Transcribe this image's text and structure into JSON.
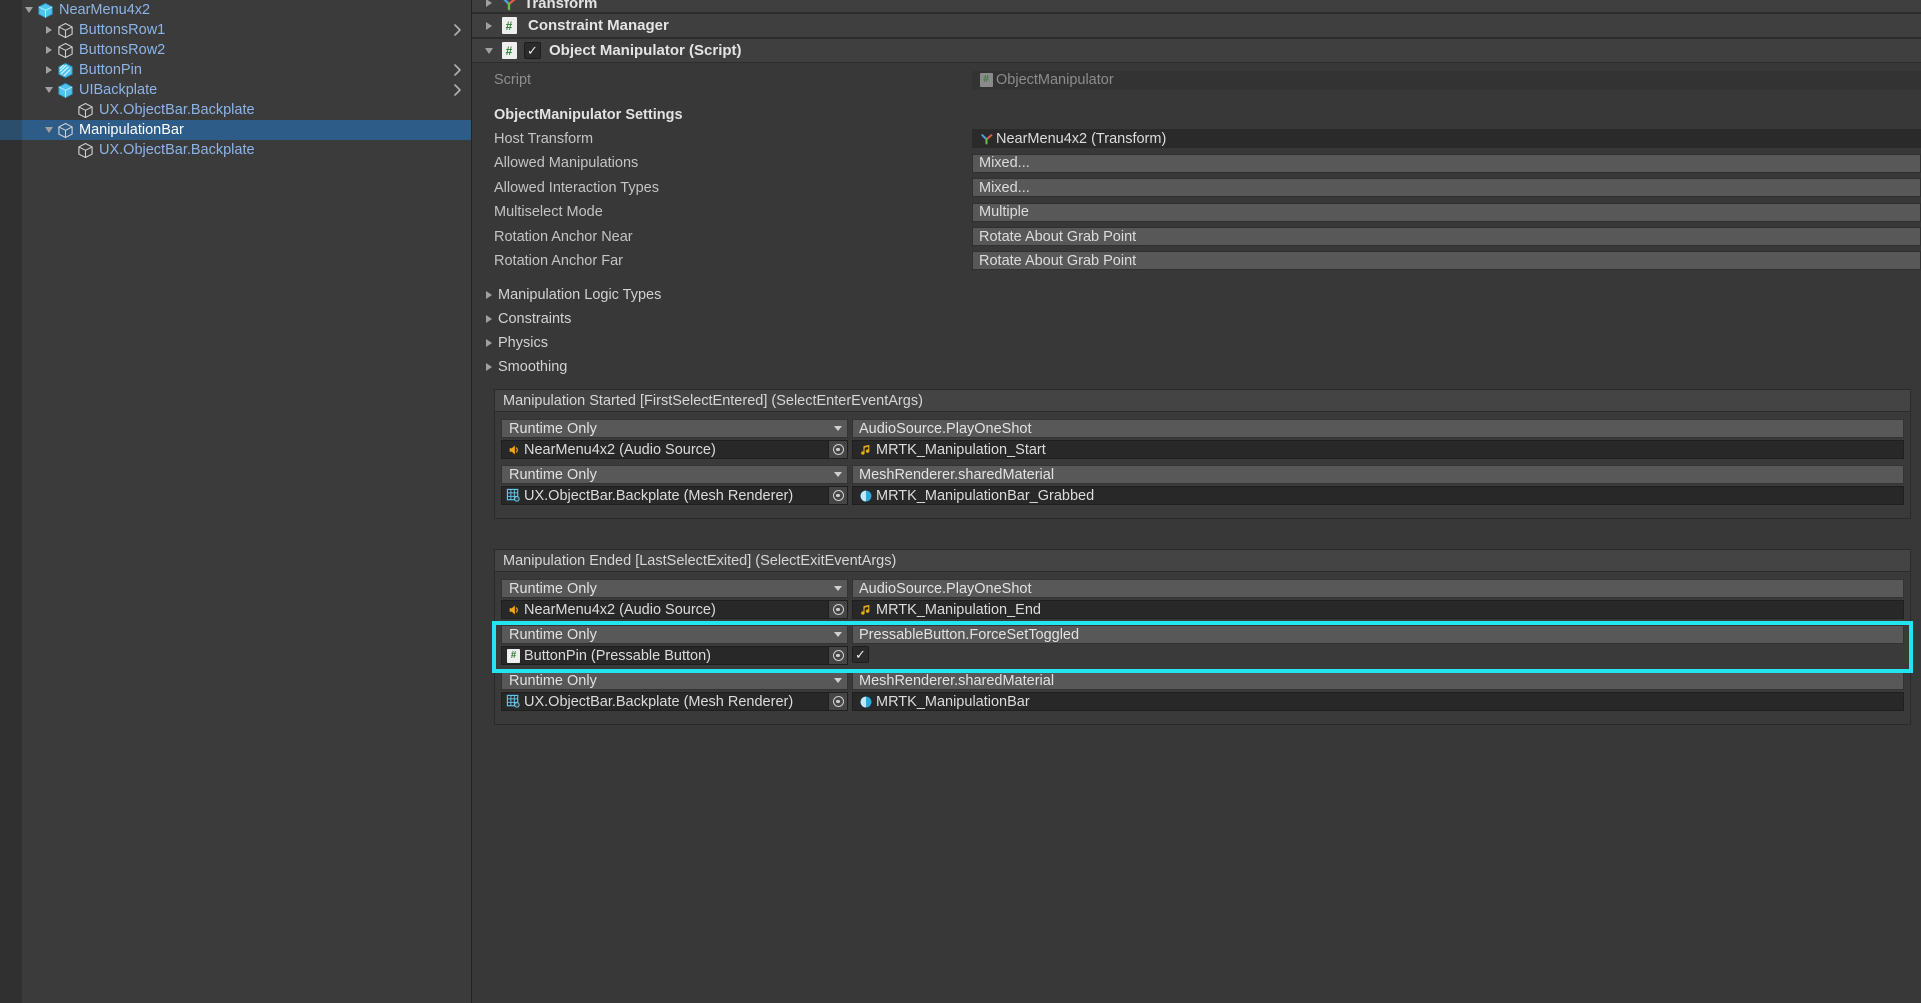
{
  "hierarchy": {
    "items": [
      {
        "label": "NearMenu4x2",
        "indent": 1,
        "twist": "down",
        "icon": "prefab-cube-icon",
        "selected": false,
        "chevron": false
      },
      {
        "label": "ButtonsRow1",
        "indent": 2,
        "twist": "right",
        "icon": "gameobject-cube-icon",
        "selected": false,
        "chevron": true
      },
      {
        "label": "ButtonsRow2",
        "indent": 2,
        "twist": "right",
        "icon": "gameobject-cube-icon",
        "selected": false,
        "chevron": false
      },
      {
        "label": "ButtonPin",
        "indent": 2,
        "twist": "right",
        "icon": "prefab-variant-cube-icon",
        "selected": false,
        "chevron": true
      },
      {
        "label": "UIBackplate",
        "indent": 2,
        "twist": "down",
        "icon": "prefab-cube-icon",
        "selected": false,
        "chevron": true
      },
      {
        "label": "UX.ObjectBar.Backplate",
        "indent": 3,
        "twist": "none",
        "icon": "gameobject-cube-icon",
        "selected": false,
        "chevron": false
      },
      {
        "label": "ManipulationBar",
        "indent": 2,
        "twist": "down",
        "icon": "gameobject-cube-icon",
        "selected": true,
        "chevron": false
      },
      {
        "label": "UX.ObjectBar.Backplate",
        "indent": 3,
        "twist": "none",
        "icon": "gameobject-cube-icon",
        "selected": false,
        "chevron": false
      }
    ]
  },
  "inspector": {
    "components": [
      {
        "title": "Transform",
        "twist": "right",
        "icon": "transform-axis-icon",
        "checkbox": null
      },
      {
        "title": "Constraint Manager",
        "twist": "right",
        "icon": "script-cs-icon",
        "checkbox": null
      },
      {
        "title": "Object Manipulator (Script)",
        "twist": "down",
        "icon": "script-cs-icon",
        "checkbox": true
      }
    ],
    "script_row": {
      "label": "Script",
      "value": "ObjectManipulator",
      "icon": "script-cs-icon"
    },
    "settings_header": "ObjectManipulator Settings",
    "settings": [
      {
        "label": "Host Transform",
        "value": "NearMenu4x2 (Transform)",
        "field": "object",
        "icon": "transform-axis-icon"
      },
      {
        "label": "Allowed Manipulations",
        "value": "Mixed...",
        "field": "enum",
        "icon": null
      },
      {
        "label": "Allowed Interaction Types",
        "value": "Mixed...",
        "field": "enum",
        "icon": null
      },
      {
        "label": "Multiselect Mode",
        "value": "Multiple",
        "field": "enum",
        "icon": null
      },
      {
        "label": "Rotation Anchor Near",
        "value": "Rotate About Grab Point",
        "field": "enum",
        "icon": null
      },
      {
        "label": "Rotation Anchor Far",
        "value": "Rotate About Grab Point",
        "field": "enum",
        "icon": null
      }
    ],
    "foldouts": [
      {
        "label": "Manipulation Logic Types"
      },
      {
        "label": "Constraints"
      },
      {
        "label": "Physics"
      },
      {
        "label": "Smoothing"
      }
    ],
    "events": [
      {
        "header": "Manipulation Started [FirstSelectEntered] (SelectEnterEventArgs)",
        "entries": [
          {
            "callstate": "Runtime Only",
            "method": "AudioSource.PlayOneShot",
            "target": "NearMenu4x2 (Audio Source)",
            "target_icon": "audio-source-icon",
            "argument": "MRTK_Manipulation_Start",
            "argument_icon": "audio-clip-icon",
            "argument_type": "asset",
            "highlight": false
          },
          {
            "callstate": "Runtime Only",
            "method": "MeshRenderer.sharedMaterial",
            "target": "UX.ObjectBar.Backplate (Mesh Renderer)",
            "target_icon": "mesh-renderer-icon",
            "argument": "MRTK_ManipulationBar_Grabbed",
            "argument_icon": "material-icon",
            "argument_type": "asset",
            "highlight": false
          }
        ]
      },
      {
        "header": "Manipulation Ended [LastSelectExited] (SelectExitEventArgs)",
        "entries": [
          {
            "callstate": "Runtime Only",
            "method": "AudioSource.PlayOneShot",
            "target": "NearMenu4x2 (Audio Source)",
            "target_icon": "audio-source-icon",
            "argument": "MRTK_Manipulation_End",
            "argument_icon": "audio-clip-icon",
            "argument_type": "asset",
            "highlight": false
          },
          {
            "callstate": "Runtime Only",
            "method": "PressableButton.ForceSetToggled",
            "target": "ButtonPin (Pressable Button)",
            "target_icon": "script-cs-icon",
            "argument": "checked",
            "argument_icon": null,
            "argument_type": "bool",
            "highlight": true
          },
          {
            "callstate": "Runtime Only",
            "method": "MeshRenderer.sharedMaterial",
            "target": "UX.ObjectBar.Backplate (Mesh Renderer)",
            "target_icon": "mesh-renderer-icon",
            "argument": "MRTK_ManipulationBar",
            "argument_icon": "material-icon",
            "argument_type": "asset",
            "highlight": false
          }
        ]
      }
    ]
  },
  "colors": {
    "highlight": "#23e5ef",
    "selection": "#2d5c88",
    "hierarchy_text": "#8cb4e8",
    "panel_bg": "#3b3b3b",
    "inspector_bg": "#383838"
  }
}
